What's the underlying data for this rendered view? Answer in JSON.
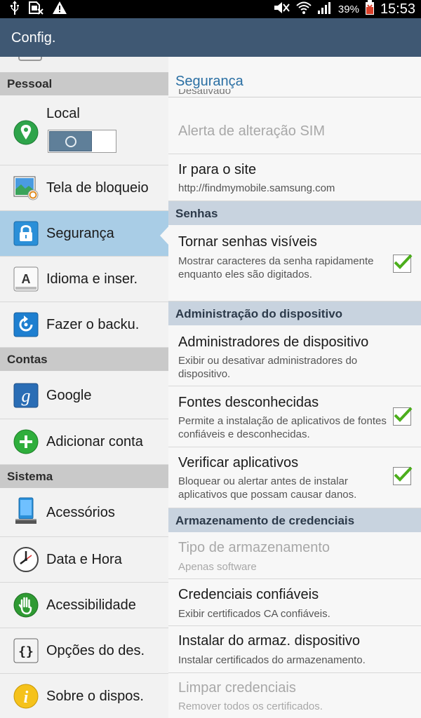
{
  "status_bar": {
    "battery_percent": "39%",
    "time": "15:53",
    "left_icons": [
      "usb-icon",
      "sim-error-icon",
      "warning-icon"
    ],
    "right_icons": [
      "mute-icon",
      "wifi-icon",
      "signal-icon",
      "battery-icon"
    ]
  },
  "action_bar": {
    "title": "Config."
  },
  "left_pane": {
    "sections": [
      {
        "header": "Pessoal"
      },
      {
        "header": "Contas"
      },
      {
        "header": "Sistema"
      }
    ],
    "items": [
      {
        "label": "Local",
        "icon": "location-icon",
        "toggle": "off"
      },
      {
        "label": "Tela de bloqueio",
        "icon": "lock-screen-icon"
      },
      {
        "label": "Segurança",
        "icon": "padlock-icon",
        "selected": true
      },
      {
        "label": "Idioma e inser.",
        "icon": "language-icon"
      },
      {
        "label": "Fazer o backu.",
        "icon": "backup-icon"
      },
      {
        "label": "Google",
        "icon": "google-icon"
      },
      {
        "label": "Adicionar conta",
        "icon": "add-account-icon"
      },
      {
        "label": "Acessórios",
        "icon": "accessory-icon"
      },
      {
        "label": "Data e Hora",
        "icon": "clock-icon"
      },
      {
        "label": "Acessibilidade",
        "icon": "hand-icon"
      },
      {
        "label": "Opções do des.",
        "icon": "braces-icon"
      },
      {
        "label": "Sobre o dispos.",
        "icon": "info-icon"
      }
    ]
  },
  "right_pane": {
    "title": "Segurança",
    "clipped_text": "Desativado",
    "items": [
      {
        "title": "Alerta de alteração SIM",
        "disabled": true
      },
      {
        "title": "Ir para o site",
        "summary": "http://findmymobile.samsung.com"
      },
      {
        "title": "Tornar senhas visíveis",
        "summary": "Mostrar caracteres da senha rapidamente enquanto eles são digitados.",
        "checked": true
      },
      {
        "title": "Administradores de dispositivo",
        "summary": "Exibir ou desativar administradores do dispositivo."
      },
      {
        "title": "Fontes desconhecidas",
        "summary": "Permite a instalação de aplicativos de fontes confiáveis e desconhecidas.",
        "checked": true
      },
      {
        "title": "Verificar aplicativos",
        "summary": "Bloquear ou alertar antes de instalar aplicativos que possam causar danos.",
        "checked": true
      },
      {
        "title": "Tipo de armazenamento",
        "summary": "Apenas software",
        "disabled": true
      },
      {
        "title": "Credenciais confiáveis",
        "summary": "Exibir certificados CA confiáveis."
      },
      {
        "title": "Instalar do armaz. dispositivo",
        "summary": "Instalar certificados do armazenamento."
      },
      {
        "title": "Limpar credenciais",
        "summary": "Remover todos os certificados.",
        "disabled": true
      }
    ],
    "headers": [
      "Senhas",
      "Administração do dispositivo",
      "Armazenamento de credenciais"
    ]
  },
  "colors": {
    "action_bar": "#3f5873",
    "selected_item": "#a9cde6",
    "title_accent": "#2a6fa3",
    "check_green": "#4cae1c"
  }
}
